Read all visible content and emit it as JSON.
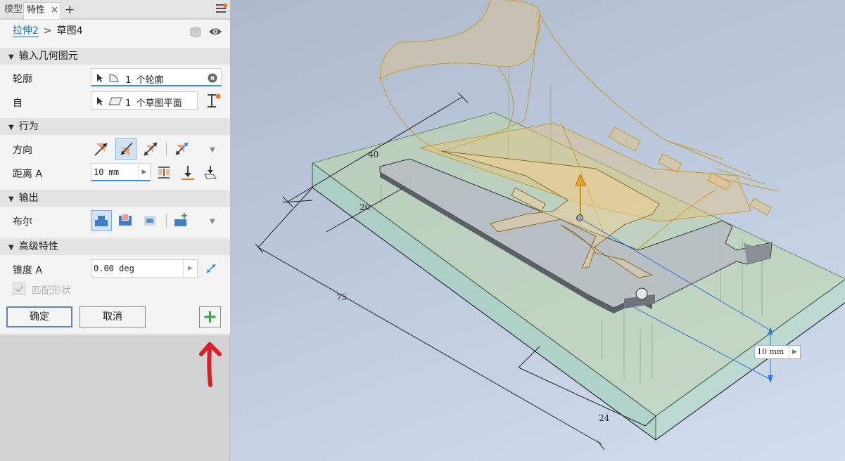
{
  "tabs": {
    "model": "模型",
    "properties": "特性",
    "close": "×",
    "add": "+"
  },
  "breadcrumb": {
    "feature": "拉伸2",
    "separator": ">",
    "sketch": "草图4"
  },
  "sections": {
    "input_geometry": "输入几何图元",
    "behavior": "行为",
    "output": "输出",
    "advanced": "高级特性"
  },
  "fields": {
    "profile_label": "轮廓",
    "profile_value": "1 个轮廓",
    "from_label": "自",
    "from_value": "1 个草图平面",
    "direction_label": "方向",
    "distance_label": "距离 A",
    "distance_value": "10 mm",
    "boolean_label": "布尔",
    "taper_label": "锥度 A",
    "taper_value": "0.00 deg",
    "match_shape_label": "匹配形状"
  },
  "buttons": {
    "ok": "确定",
    "cancel": "取消",
    "add": "+"
  },
  "dimensions": {
    "d40": "40",
    "d20": "20",
    "d75": "75",
    "d24": "24",
    "distance_box": "10 mm"
  },
  "colors": {
    "accent": "#1a6fb0",
    "selection": "#cfe3f5",
    "add_green": "#3aa84a",
    "annotation_arrow": "#d8202a",
    "orange_dot": "#f07a23"
  },
  "icons": [
    "select-arrow-icon",
    "profile-icon",
    "plane-icon",
    "clear-icon",
    "flip-icon",
    "direction-default-icon",
    "direction-flipped-icon",
    "direction-symmetric-icon",
    "direction-asymmetric-icon",
    "distance-icon",
    "through-next-icon",
    "to-icon",
    "join-icon",
    "cut-icon",
    "intersect-icon",
    "new-solid-icon",
    "taper-flip-icon",
    "menu-icon",
    "add-icon",
    "arrow-up-annotation"
  ]
}
